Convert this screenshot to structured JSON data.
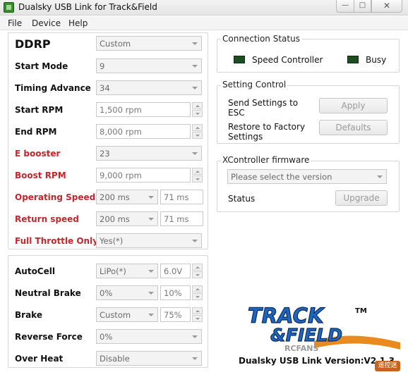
{
  "window": {
    "title": "Dualsky USB Link for Track&Field",
    "min": "—",
    "max": "□",
    "close": "✕"
  },
  "menu": {
    "items": [
      "File",
      "Device",
      "Help"
    ]
  },
  "params": {
    "heading": "DDRP",
    "preset": "Custom",
    "rows": [
      {
        "label": "Start Mode",
        "value": "9"
      },
      {
        "label": "Timing Advance",
        "value": "34"
      },
      {
        "label": "Start RPM",
        "value": "1,500 rpm"
      },
      {
        "label": "End RPM",
        "value": "8,000 rpm"
      },
      {
        "label": "E booster",
        "value": "23"
      },
      {
        "label": "Boost RPM",
        "value": "9,000 rpm"
      },
      {
        "label": "Operating Speed",
        "value": "200 ms",
        "value2": "71 ms"
      },
      {
        "label": "Return speed",
        "value": "200 ms",
        "value2": "71 ms"
      },
      {
        "label": "Full Throttle Only",
        "value": "Yes(*)"
      }
    ]
  },
  "misc": {
    "rows": [
      {
        "label": "AutoCell",
        "value": "LiPo(*)",
        "value2": "6.0V"
      },
      {
        "label": "Neutral Brake",
        "value": "0%",
        "value2": "10%"
      },
      {
        "label": "Brake",
        "value": "Custom",
        "value2": "75%"
      },
      {
        "label": "Reverse Force",
        "value": "0%"
      },
      {
        "label": "Over Heat",
        "value": "Disable"
      }
    ]
  },
  "connection": {
    "title": "Connection Status",
    "speed_controller": "Speed Controller",
    "busy": "Busy",
    "led_color": "#1e4d22"
  },
  "setting": {
    "title": "Setting Control",
    "send_line1": "Send Settings to",
    "send_line2": "ESC",
    "restore_line1": "Restore to Factory",
    "restore_line2": "Settings",
    "apply": "Apply",
    "defaults": "Defaults"
  },
  "firmware": {
    "title": "XController firmware",
    "placeholder": "Please select the version",
    "status": "Status",
    "upgrade": "Upgrade"
  },
  "brand": {
    "logo_line1": "TRACK",
    "logo_line2": "&FIELD",
    "tm": "TM",
    "rcfans": "RCFANS",
    "version": "Dualsky USB Link Version:V2.1.3",
    "watermark": "遥控迷"
  },
  "colors": {
    "accent_red": "#c1272d",
    "logo_blue": "#1d67c2"
  }
}
